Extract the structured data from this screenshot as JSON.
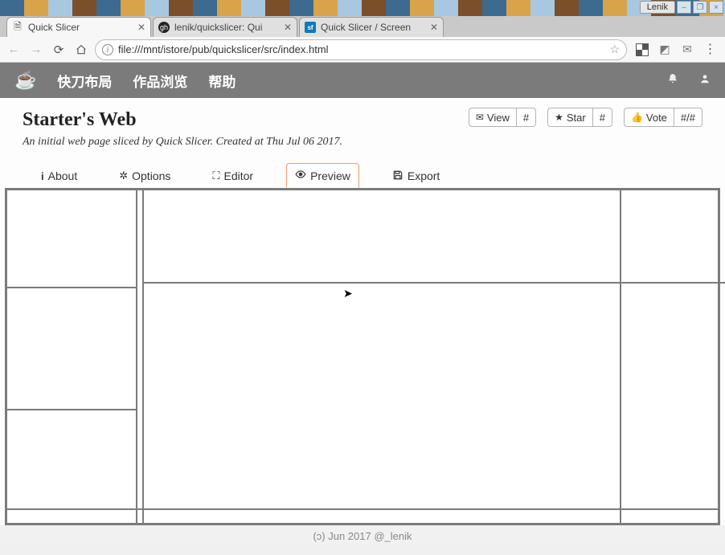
{
  "os": {
    "user_label": "Lenik",
    "minimize": "–",
    "maximize": "❐",
    "close": "×"
  },
  "browser": {
    "tabs": [
      {
        "title": "Quick Slicer",
        "favicon": "page-icon"
      },
      {
        "title": "lenik/quickslicer: Qui",
        "favicon": "github-icon"
      },
      {
        "title": "Quick Slicer / Screen",
        "favicon": "sf-icon"
      }
    ],
    "url": "file:///mnt/istore/pub/quickslicer/src/index.html"
  },
  "app_nav": {
    "items": [
      "快刀布局",
      "作品浏览",
      "帮助"
    ]
  },
  "page": {
    "title": "Starter's Web",
    "subtitle": "An initial web page sliced by Quick Slicer. Created at Thu Jul 06 2017."
  },
  "action_groups": {
    "view": {
      "label": "View",
      "count": "#"
    },
    "star": {
      "label": "Star",
      "count": "#"
    },
    "vote": {
      "label": "Vote",
      "count": "#/#"
    }
  },
  "tabs": {
    "about": "About",
    "options": "Options",
    "editor": "Editor",
    "preview": "Preview",
    "export": "Export"
  },
  "footer": "(ɔ) Jun 2017 @_lenik"
}
